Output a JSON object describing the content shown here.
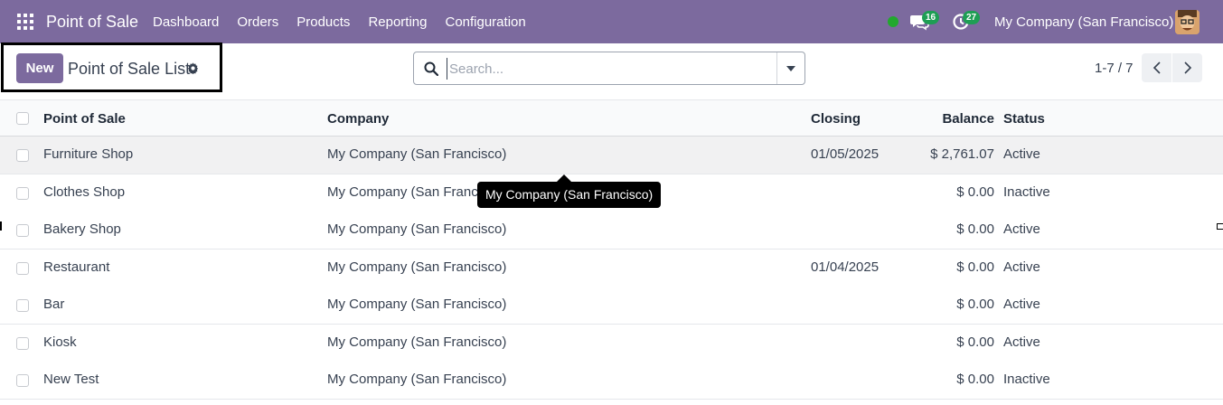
{
  "navbar": {
    "brand": "Point of Sale",
    "menu": [
      "Dashboard",
      "Orders",
      "Products",
      "Reporting",
      "Configuration"
    ],
    "chat_count": "16",
    "activity_count": "27",
    "company": "My Company (San Francisco)",
    "icons": [
      "apps-grid-icon",
      "chat-icon",
      "activity-clock-icon",
      "avatar"
    ],
    "colors": {
      "navbar": "#7c6a9e",
      "presence": "#22a82e",
      "badge": "#1e9e54"
    }
  },
  "control": {
    "new_label": "New",
    "title": "Point of Sale List",
    "search_placeholder": "Search...",
    "pager": "1-7 / 7"
  },
  "table": {
    "headers": {
      "name": "Point of Sale",
      "company": "Company",
      "closing": "Closing",
      "balance": "Balance",
      "status": "Status"
    },
    "rows": [
      {
        "name": "Furniture Shop",
        "company": "My Company (San Francisco)",
        "closing": "01/05/2025",
        "balance": "$ 2,761.07",
        "status": "Active"
      },
      {
        "name": "Clothes Shop",
        "company": "My Company (San Francisco)",
        "closing": "",
        "balance": "$ 0.00",
        "status": "Inactive"
      },
      {
        "name": "Bakery Shop",
        "company": "My Company (San Francisco)",
        "closing": "",
        "balance": "$ 0.00",
        "status": "Active"
      },
      {
        "name": "Restaurant",
        "company": "My Company (San Francisco)",
        "closing": "01/04/2025",
        "balance": "$ 0.00",
        "status": "Active"
      },
      {
        "name": "Bar",
        "company": "My Company (San Francisco)",
        "closing": "",
        "balance": "$ 0.00",
        "status": "Active"
      },
      {
        "name": "Kiosk",
        "company": "My Company (San Francisco)",
        "closing": "",
        "balance": "$ 0.00",
        "status": "Active"
      },
      {
        "name": "New Test",
        "company": "My Company (San Francisco)",
        "closing": "",
        "balance": "$ 0.00",
        "status": "Inactive"
      }
    ]
  },
  "tooltip": {
    "text": "My Company (San Francisco)"
  }
}
